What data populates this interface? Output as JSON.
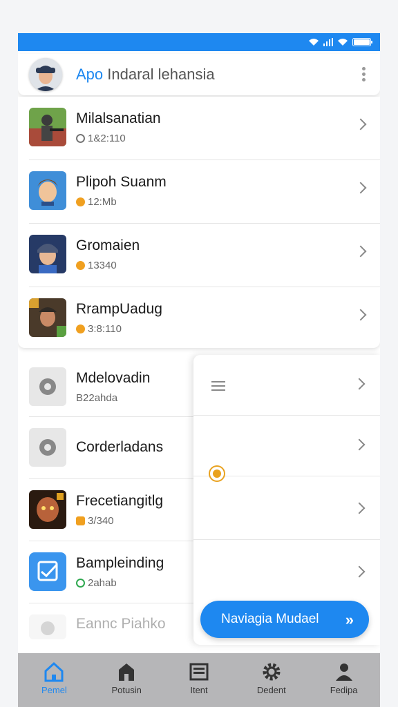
{
  "header": {
    "title_accent": "Apo",
    "title_rest": "Indaral lehansia",
    "avatar_icon": "user-avatar-icon",
    "more_icon": "more-vert-icon"
  },
  "status_bar": {
    "icons": [
      "wifi-icon",
      "signal-icon",
      "wifi-icon",
      "battery-icon"
    ]
  },
  "list_top": [
    {
      "title": "Milalsanatian",
      "sub": "1&2:110",
      "badge": "clock-icon",
      "badge_color": "#777777",
      "thumb": "soldier-game-icon"
    },
    {
      "title": "Plipoh Suanm",
      "sub": "12:Mb",
      "badge": "coin-icon",
      "badge_color": "#f0a020",
      "thumb": "elf-game-icon"
    },
    {
      "title": "Gromaien",
      "sub": "13340",
      "badge": "coin-icon",
      "badge_color": "#f0a020",
      "thumb": "helmet-game-icon"
    },
    {
      "title": "RrampUadug",
      "sub": "3:8:110",
      "badge": "coin-icon",
      "badge_color": "#f0a020",
      "thumb": "warrior-game-icon"
    }
  ],
  "list_bottom": [
    {
      "title": "Mdelovadin",
      "sub": "B22ahda",
      "badge": "",
      "thumb": "gear-placeholder-icon"
    },
    {
      "title": "Corderladans",
      "sub": "",
      "badge": "",
      "thumb": "gear-placeholder-icon"
    },
    {
      "title": "Frecetiangitlg",
      "sub": "3/340",
      "badge": "coin-icon",
      "badge_color": "#f0a020",
      "thumb": "face-game-icon"
    },
    {
      "title": "Bampleinding",
      "sub": "2ahab",
      "badge": "clock-icon",
      "badge_color": "#2fa84f",
      "thumb": "checkbox-app-icon"
    },
    {
      "title": "Eannc Piahko",
      "sub": "",
      "badge": "",
      "thumb": "gear-placeholder-icon"
    }
  ],
  "fab": {
    "label": "Naviagia Mudael",
    "icon": "chevron-double-right-icon"
  },
  "bottom_nav": [
    {
      "label": "Pemel",
      "icon": "home-icon",
      "active": true
    },
    {
      "label": "Potusin",
      "icon": "store-icon",
      "active": false
    },
    {
      "label": "Itent",
      "icon": "news-icon",
      "active": false
    },
    {
      "label": "Dedent",
      "icon": "gear-icon",
      "active": false
    },
    {
      "label": "Fedipa",
      "icon": "person-icon",
      "active": false
    }
  ],
  "colors": {
    "accent": "#1e88f0",
    "coin": "#f0a020",
    "green": "#2fa84f"
  }
}
